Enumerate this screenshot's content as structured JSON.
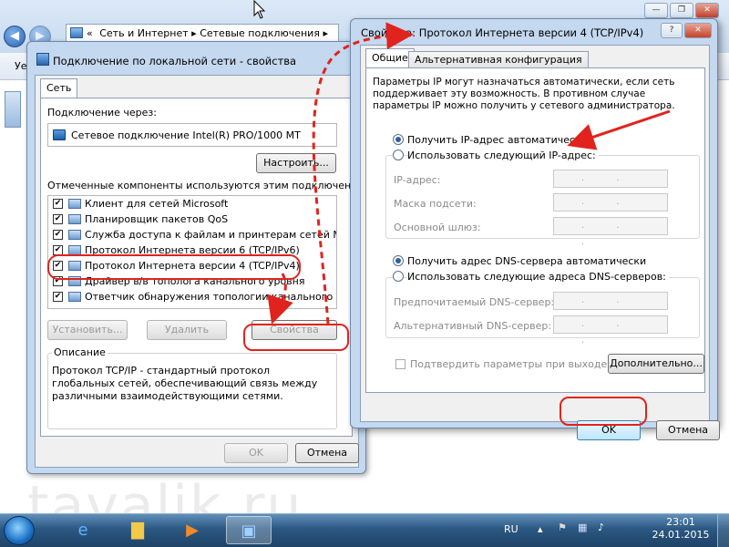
{
  "explorer": {
    "breadcrumb": [
      "«",
      "Сеть и Интернет",
      "Сетевые подключения"
    ],
    "toolbar_fragment": "Уе",
    "controls": {
      "minimize": "—",
      "maximize": "❐",
      "close": "✕"
    }
  },
  "left_dialog": {
    "title": "Подключение по локальной сети - свойства",
    "tab": "Сеть",
    "connect_via_label": "Подключение через:",
    "adapter_name": "Сетевое подключение Intel(R) PRO/1000 MT",
    "configure_button": "Настроить...",
    "components_label": "Отмеченные компоненты используются этим подключением:",
    "components": [
      {
        "label": "Клиент для сетей Microsoft",
        "checked": true
      },
      {
        "label": "Планировщик пакетов QoS",
        "checked": true
      },
      {
        "label": "Служба доступа к файлам и принтерам сетей Micro...",
        "checked": true
      },
      {
        "label": "Протокол Интернета версии 6 (TCP/IPv6)",
        "checked": true
      },
      {
        "label": "Протокол Интернета версии 4 (TCP/IPv4)",
        "checked": true
      },
      {
        "label": "Драйвер в/в тополога канального уровня",
        "checked": true
      },
      {
        "label": "Ответчик обнаружения топологии канального уровня",
        "checked": true
      }
    ],
    "install_button": "Установить...",
    "remove_button": "Удалить",
    "properties_button": "Свойства",
    "description_label": "Описание",
    "description_text": "Протокол TCP/IP - стандартный протокол глобальных сетей, обеспечивающий связь между различными взаимодействующими сетями.",
    "ok_button": "OK",
    "cancel_button": "Отмена"
  },
  "right_dialog": {
    "title": "Свойства: Протокол Интернета версии 4 (TCP/IPv4)",
    "help_button": "?",
    "close_button": "✕",
    "tabs": [
      "Общие",
      "Альтернативная конфигурация"
    ],
    "intro_text": "Параметры IP могут назначаться автоматически, если сеть поддерживает эту возможность. В противном случае параметры IP можно получить у сетевого администратора.",
    "ip_auto": "Получить IP-адрес автоматически",
    "ip_manual": "Использовать следующий IP-адрес:",
    "ip_address_label": "IP-адрес:",
    "subnet_label": "Маска подсети:",
    "gateway_label": "Основной шлюз:",
    "dns_auto": "Получить адрес DNS-сервера автоматически",
    "dns_manual": "Использовать следующие адреса DNS-серверов:",
    "dns_preferred_label": "Предпочитаемый DNS-сервер:",
    "dns_alternate_label": "Альтернативный DNS-сервер:",
    "validate_label": "Подтвердить параметры при выходе",
    "advanced_button": "Дополнительно...",
    "ok_button": "OK",
    "cancel_button": "Отмена",
    "ip_auto_selected": true,
    "dns_auto_selected": true,
    "ip_placeholder": ". . ."
  },
  "taskbar": {
    "lang": "RU",
    "time": "23:01",
    "date": "24.01.2015"
  },
  "watermark": "tavalik.ru",
  "colors": {
    "annotation_red": "#e0241d",
    "selection_blue": "#2a5fa3"
  }
}
